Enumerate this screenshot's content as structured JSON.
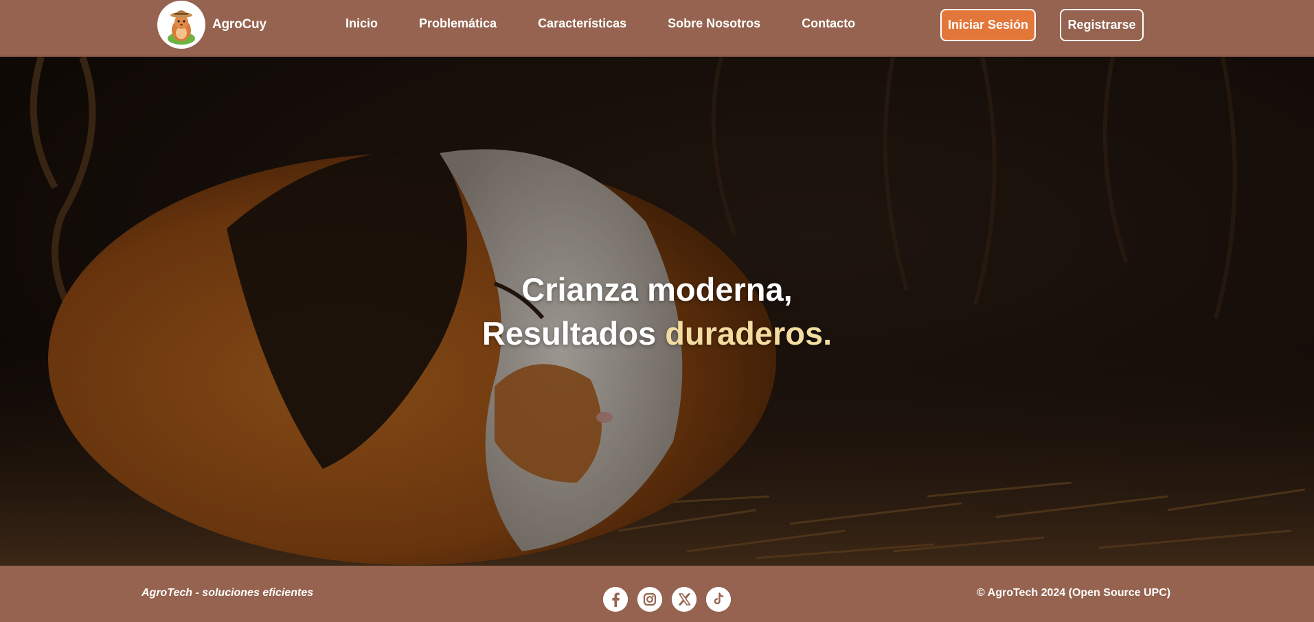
{
  "brand": {
    "name": "AgroCuy",
    "logo_icon": "farmer-guinea-pig-logo-icon"
  },
  "nav": {
    "items": [
      {
        "label": "Inicio"
      },
      {
        "label": "Problemática"
      },
      {
        "label": "Características"
      },
      {
        "label": "Sobre Nosotros"
      },
      {
        "label": "Contacto"
      }
    ]
  },
  "auth": {
    "login_label": "Iniciar Sesión",
    "register_label": "Registrarse"
  },
  "hero": {
    "line1": "Crianza moderna,",
    "line2_prefix": "Resultados",
    "line2_accent": "duraderos."
  },
  "footer": {
    "tagline": "AgroTech - soluciones eficientes",
    "socials": [
      {
        "icon": "facebook-icon"
      },
      {
        "icon": "instagram-icon"
      },
      {
        "icon": "x-twitter-icon"
      },
      {
        "icon": "tiktok-icon"
      }
    ],
    "copyright": "© AgroTech 2024 (Open Source UPC)"
  },
  "colors": {
    "header_bg": "#95634f",
    "login_button_bg": "#e3773a",
    "headline_accent": "#f3dca0"
  }
}
